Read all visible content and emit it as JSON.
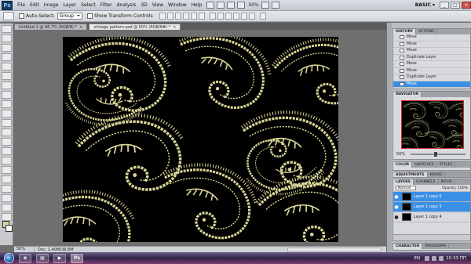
{
  "app": {
    "logo": "Ps",
    "workspace": "BASIC ▾",
    "zoom": "50%"
  },
  "menu": [
    "File",
    "Edit",
    "Image",
    "Layer",
    "Select",
    "Filter",
    "Analysis",
    "3D",
    "View",
    "Window",
    "Help"
  ],
  "options_bar": {
    "auto_select_label": "Auto-Select:",
    "auto_select_value": "Group",
    "transform_label": "Show Transform Controls"
  },
  "document_tabs": [
    {
      "label": "Untitled-1 @ 66.7% (RGB/8) *",
      "active": false
    },
    {
      "label": "vintage pattern.psd @ 50% (RGB/8#) *",
      "active": true
    }
  ],
  "status_bar": {
    "zoom": "50%",
    "doc": "Doc: 1.40M/38.8M"
  },
  "history": {
    "tabs": [
      "HISTORY",
      "ACTIONS"
    ],
    "items": [
      {
        "label": "Move",
        "selected": false
      },
      {
        "label": "Move",
        "selected": false
      },
      {
        "label": "Move",
        "selected": false
      },
      {
        "label": "Duplicate Layer",
        "selected": false
      },
      {
        "label": "Move",
        "selected": false
      },
      {
        "label": "Move",
        "selected": false
      },
      {
        "label": "Duplicate Layer",
        "selected": false
      },
      {
        "label": "Move",
        "selected": true
      }
    ]
  },
  "navigator": {
    "tab": "NAVIGATOR",
    "zoom": "50%"
  },
  "color_tabs": [
    "COLOR",
    "SWATCHES",
    "STYLES"
  ],
  "adjust_tabs": [
    "ADJUSTMENTS",
    "MASKS"
  ],
  "layers": {
    "tabs": [
      "LAYERS",
      "CHANNELS",
      "PATHS"
    ],
    "blend_mode": "Normal",
    "opacity": "Opacity: 100%",
    "items": [
      {
        "label": "Layer 1 copy 6",
        "selected": true
      },
      {
        "label": "Layer 1 copy 5",
        "selected": true
      },
      {
        "label": "Layer 1 copy 4",
        "selected": false
      }
    ]
  },
  "char_tabs": [
    "CHARACTER",
    "PARAGRAPH"
  ],
  "taskbar": {
    "apps": [
      "e",
      "▤",
      "▶",
      "Ps"
    ],
    "lang": "EN",
    "clock": "10:33 ПП"
  },
  "colors": {
    "paisley": "#d9d596",
    "selection": "#3a8fe6",
    "canvas_bg": "#000000"
  }
}
